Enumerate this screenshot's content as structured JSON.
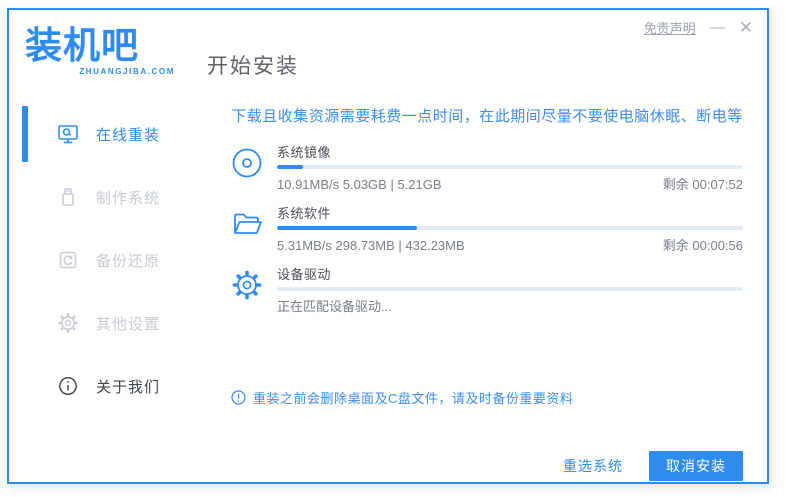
{
  "colors": {
    "accent": "#2e8cf0",
    "warning_text": "#3d8df5",
    "bar_background": "#e4ebf4",
    "inactive_text": "#c5cbd3"
  },
  "header": {
    "logo_text": "装机吧",
    "logo_domain": "ZHUANGJIBA.COM",
    "page_title": "开始安装",
    "disclaimer_link": "免责声明",
    "minimize_glyph": "—",
    "close_glyph": "✕"
  },
  "sidebar": {
    "items": [
      {
        "label": "在线重装",
        "state": "active"
      },
      {
        "label": "制作系统",
        "state": "disabled"
      },
      {
        "label": "备份还原",
        "state": "disabled"
      },
      {
        "label": "其他设置",
        "state": "disabled"
      },
      {
        "label": "关于我们",
        "state": "normal"
      }
    ]
  },
  "main": {
    "warning": "下载且收集资源需要耗费一点时间，在此期间尽量不要使电脑休眠、断电等",
    "tasks": [
      {
        "name": "系统镜像",
        "stats": "10.91MB/s 5.03GB | 5.21GB",
        "remaining": "剩余 00:07:52",
        "progress_pct": 5.5
      },
      {
        "name": "系统软件",
        "stats": "5.31MB/s 298.73MB | 432.23MB",
        "remaining": "剩余 00:00:56",
        "progress_pct": 30
      },
      {
        "name": "设备驱动",
        "stats": "正在匹配设备驱动...",
        "remaining": "",
        "progress_pct": 0
      }
    ],
    "note": "重装之前会删除桌面及C盘文件，请及时备份重要资料",
    "buttons": {
      "reselect": "重选系统",
      "cancel": "取消安装"
    }
  }
}
